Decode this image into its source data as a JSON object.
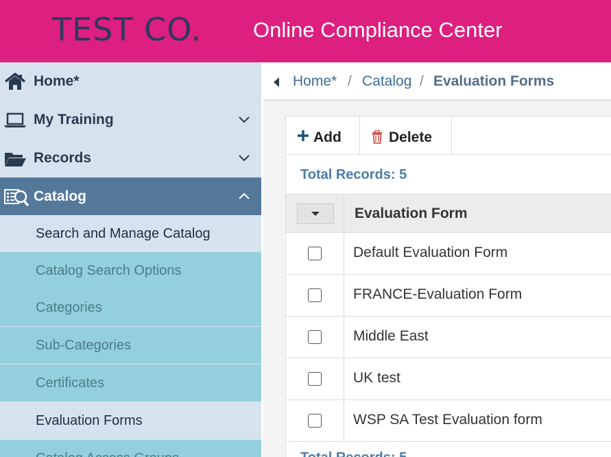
{
  "header": {
    "logo": "TEST CO.",
    "title": "Online Compliance Center",
    "background": "#dd1f7f"
  },
  "sidebar": {
    "items": [
      {
        "label": "Home*",
        "icon": "home-icon"
      },
      {
        "label": "My Training",
        "icon": "laptop-icon",
        "chevron": "chevron-down-icon"
      },
      {
        "label": "Records",
        "icon": "folder-open-icon",
        "chevron": "chevron-down-icon"
      },
      {
        "label": "Catalog",
        "icon": "catalog-search-icon",
        "chevron": "chevron-up-icon",
        "active": true
      }
    ],
    "catalog_sub": [
      {
        "label": "Search and Manage Catalog"
      },
      {
        "label": "Catalog Search Options"
      },
      {
        "label": "Categories"
      },
      {
        "label": "Sub-Categories"
      },
      {
        "label": "Certificates"
      },
      {
        "label": "Evaluation Forms",
        "selected": true
      },
      {
        "label": "Catalog Access Groups"
      }
    ]
  },
  "breadcrumb": {
    "items": [
      "Home*",
      "Catalog"
    ],
    "separator": "/",
    "current": "Evaluation Forms"
  },
  "toolbar": {
    "add_label": "Add",
    "delete_label": "Delete"
  },
  "records": {
    "total_label": "Total Records: 5",
    "column_header": "Evaluation Form",
    "rows": [
      {
        "name": "Default Evaluation Form",
        "checked": false
      },
      {
        "name": "FRANCE-Evaluation Form",
        "checked": false
      },
      {
        "name": "Middle East",
        "checked": false
      },
      {
        "name": "UK test",
        "checked": false
      },
      {
        "name": "WSP SA Test Evaluation form",
        "checked": false
      }
    ]
  },
  "colors": {
    "accent_pink": "#dd1f7f",
    "sidebar_bg": "#d6e3ef",
    "active_nav": "#53789a",
    "submenu_teal": "#93cfdc",
    "link_blue": "#3b6d98"
  }
}
